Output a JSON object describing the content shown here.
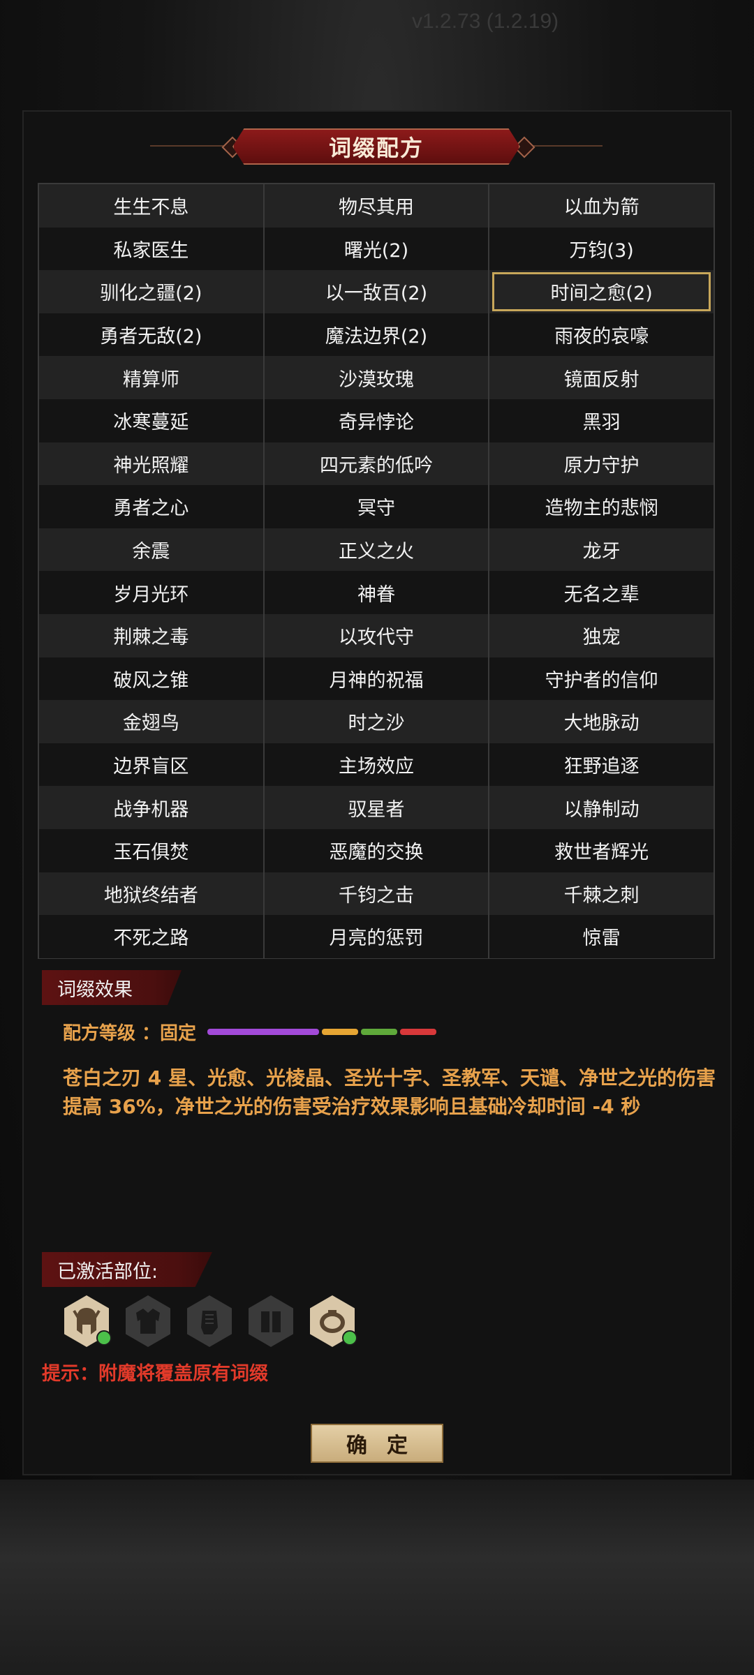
{
  "version": "v1.2.73 (1.2.19)",
  "title": "词缀配方",
  "grid": {
    "rows": [
      [
        "生生不息",
        "物尽其用",
        "以血为箭"
      ],
      [
        "私家医生",
        "曙光(2)",
        "万钧(3)"
      ],
      [
        "驯化之疆(2)",
        "以一敌百(2)",
        "时间之愈(2)"
      ],
      [
        "勇者无敌(2)",
        "魔法边界(2)",
        "雨夜的哀嚎"
      ],
      [
        "精算师",
        "沙漠玫瑰",
        "镜面反射"
      ],
      [
        "冰寒蔓延",
        "奇异悖论",
        "黑羽"
      ],
      [
        "神光照耀",
        "四元素的低吟",
        "原力守护"
      ],
      [
        "勇者之心",
        "冥守",
        "造物主的悲悯"
      ],
      [
        "余震",
        "正义之火",
        "龙牙"
      ],
      [
        "岁月光环",
        "神眷",
        "无名之辈"
      ],
      [
        "荆棘之毒",
        "以攻代守",
        "独宠"
      ],
      [
        "破风之锥",
        "月神的祝福",
        "守护者的信仰"
      ],
      [
        "金翅鸟",
        "时之沙",
        "大地脉动"
      ],
      [
        "边界盲区",
        "主场效应",
        "狂野追逐"
      ],
      [
        "战争机器",
        "驭星者",
        "以静制动"
      ],
      [
        "玉石俱焚",
        "恶魔的交换",
        "救世者辉光"
      ],
      [
        "地狱终结者",
        "千钧之击",
        "千棘之刺"
      ],
      [
        "不死之路",
        "月亮的惩罚",
        "惊雷"
      ]
    ],
    "selected": "时间之愈(2)"
  },
  "effect_section": {
    "label": "词缀效果",
    "grade_label": "配方等级 ：固定",
    "grade_colors": [
      "#a24ad8",
      "#e6a533",
      "#5fa93a",
      "#d8383a"
    ],
    "description": "苍白之刃 4 星、光愈、光棱晶、圣光十字、圣教军、天谴、净世之光的伤害提高 36%，净世之光的伤害受治疗效果影响且基础冷却时间 -4 秒"
  },
  "activated_section": {
    "label": "已激活部位:",
    "parts": [
      {
        "icon": "helmet-icon",
        "active": true
      },
      {
        "icon": "armor-icon",
        "active": false
      },
      {
        "icon": "gloves-icon",
        "active": false
      },
      {
        "icon": "boots-icon",
        "active": false
      },
      {
        "icon": "ring-icon",
        "active": true
      }
    ]
  },
  "hint": "提示：附魔将覆盖原有词缀",
  "confirm_label": "确定"
}
